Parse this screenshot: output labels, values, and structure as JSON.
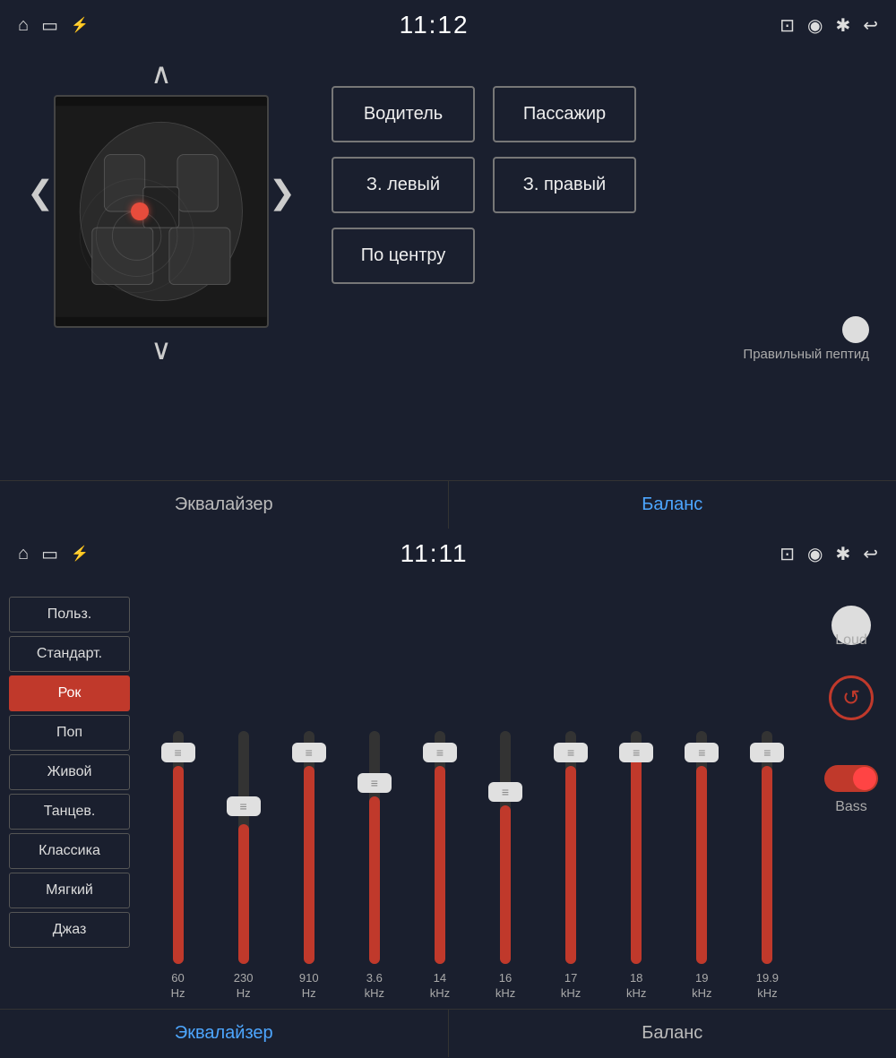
{
  "top": {
    "statusBar": {
      "time": "11:12",
      "icons": {
        "home": "⌂",
        "screen": "▭",
        "usb": "⚡",
        "cast": "⊡",
        "location": "◉",
        "bluetooth": "✱",
        "back": "↩"
      }
    },
    "zones": {
      "driver": "Водитель",
      "passenger": "Пассажир",
      "rearLeft": "З. левый",
      "rearRight": "З. правый",
      "center": "По центру"
    },
    "toneLabel": "Правильный пептид",
    "navArrowUp": "∧",
    "navArrowDown": "∨",
    "navArrowLeft": "❮",
    "navArrowRight": "❯",
    "tabs": {
      "equalizer": "Эквалайзер",
      "balance": "Баланс"
    }
  },
  "bottom": {
    "statusBar": {
      "time": "11:11"
    },
    "presets": [
      {
        "id": "custom",
        "label": "Польз.",
        "active": false
      },
      {
        "id": "standard",
        "label": "Стандарт.",
        "active": false
      },
      {
        "id": "rock",
        "label": "Рок",
        "active": true
      },
      {
        "id": "pop",
        "label": "Поп",
        "active": false
      },
      {
        "id": "live",
        "label": "Живой",
        "active": false
      },
      {
        "id": "dance",
        "label": "Танцев.",
        "active": false
      },
      {
        "id": "classic",
        "label": "Классика",
        "active": false
      },
      {
        "id": "soft",
        "label": "Мягкий",
        "active": false
      },
      {
        "id": "jazz",
        "label": "Джаз",
        "active": false
      }
    ],
    "sliders": [
      {
        "freq": "60",
        "unit": "Hz",
        "fillPct": 85
      },
      {
        "freq": "230",
        "unit": "Hz",
        "fillPct": 60
      },
      {
        "freq": "910",
        "unit": "Hz",
        "fillPct": 85
      },
      {
        "freq": "3.6",
        "unit": "kHz",
        "fillPct": 72
      },
      {
        "freq": "14",
        "unit": "kHz",
        "fillPct": 85
      },
      {
        "freq": "16",
        "unit": "kHz",
        "fillPct": 68
      },
      {
        "freq": "17",
        "unit": "kHz",
        "fillPct": 85
      },
      {
        "freq": "18",
        "unit": "kHz",
        "fillPct": 90
      },
      {
        "freq": "19",
        "unit": "kHz",
        "fillPct": 85
      },
      {
        "freq": "19.9",
        "unit": "kHz",
        "fillPct": 85
      }
    ],
    "controls": {
      "loudLabel": "Loud",
      "resetLabel": "↺",
      "bassLabel": "Bass"
    },
    "tabs": {
      "equalizer": "Эквалайзер",
      "balance": "Баланс"
    }
  }
}
